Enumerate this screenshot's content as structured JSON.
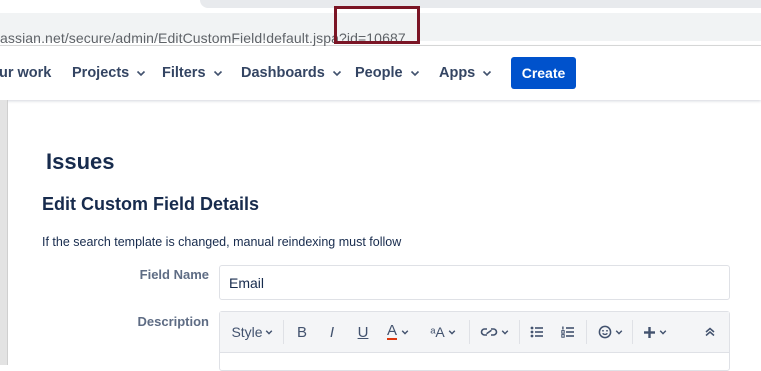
{
  "browser": {
    "url": "assian.net/secure/admin/EditCustomField!default.jspa?id=10687"
  },
  "topnav": {
    "items": [
      {
        "label": "ur work"
      },
      {
        "label": "Projects"
      },
      {
        "label": "Filters"
      },
      {
        "label": "Dashboards"
      },
      {
        "label": "People"
      },
      {
        "label": "Apps"
      }
    ],
    "create_label": "Create",
    "accent": "#0052cc"
  },
  "page": {
    "title": "Issues",
    "section_title": "Edit Custom Field Details",
    "note": "If the search template is changed, manual reindexing must follow",
    "field_name_label": "Field Name",
    "field_name_value": "Email",
    "description_label": "Description"
  },
  "editor_toolbar": {
    "style_label": "Style",
    "bold": "B",
    "italic": "I",
    "underline": "U",
    "text_color": "A",
    "more_format": "ᵃA",
    "icons": [
      "bold-icon",
      "italic-icon",
      "underline-icon",
      "text-color-icon",
      "more-formatting-icon",
      "link-icon",
      "bullet-list-icon",
      "numbered-list-icon",
      "emoji-icon",
      "insert-plus-icon",
      "collapse-icon"
    ]
  }
}
